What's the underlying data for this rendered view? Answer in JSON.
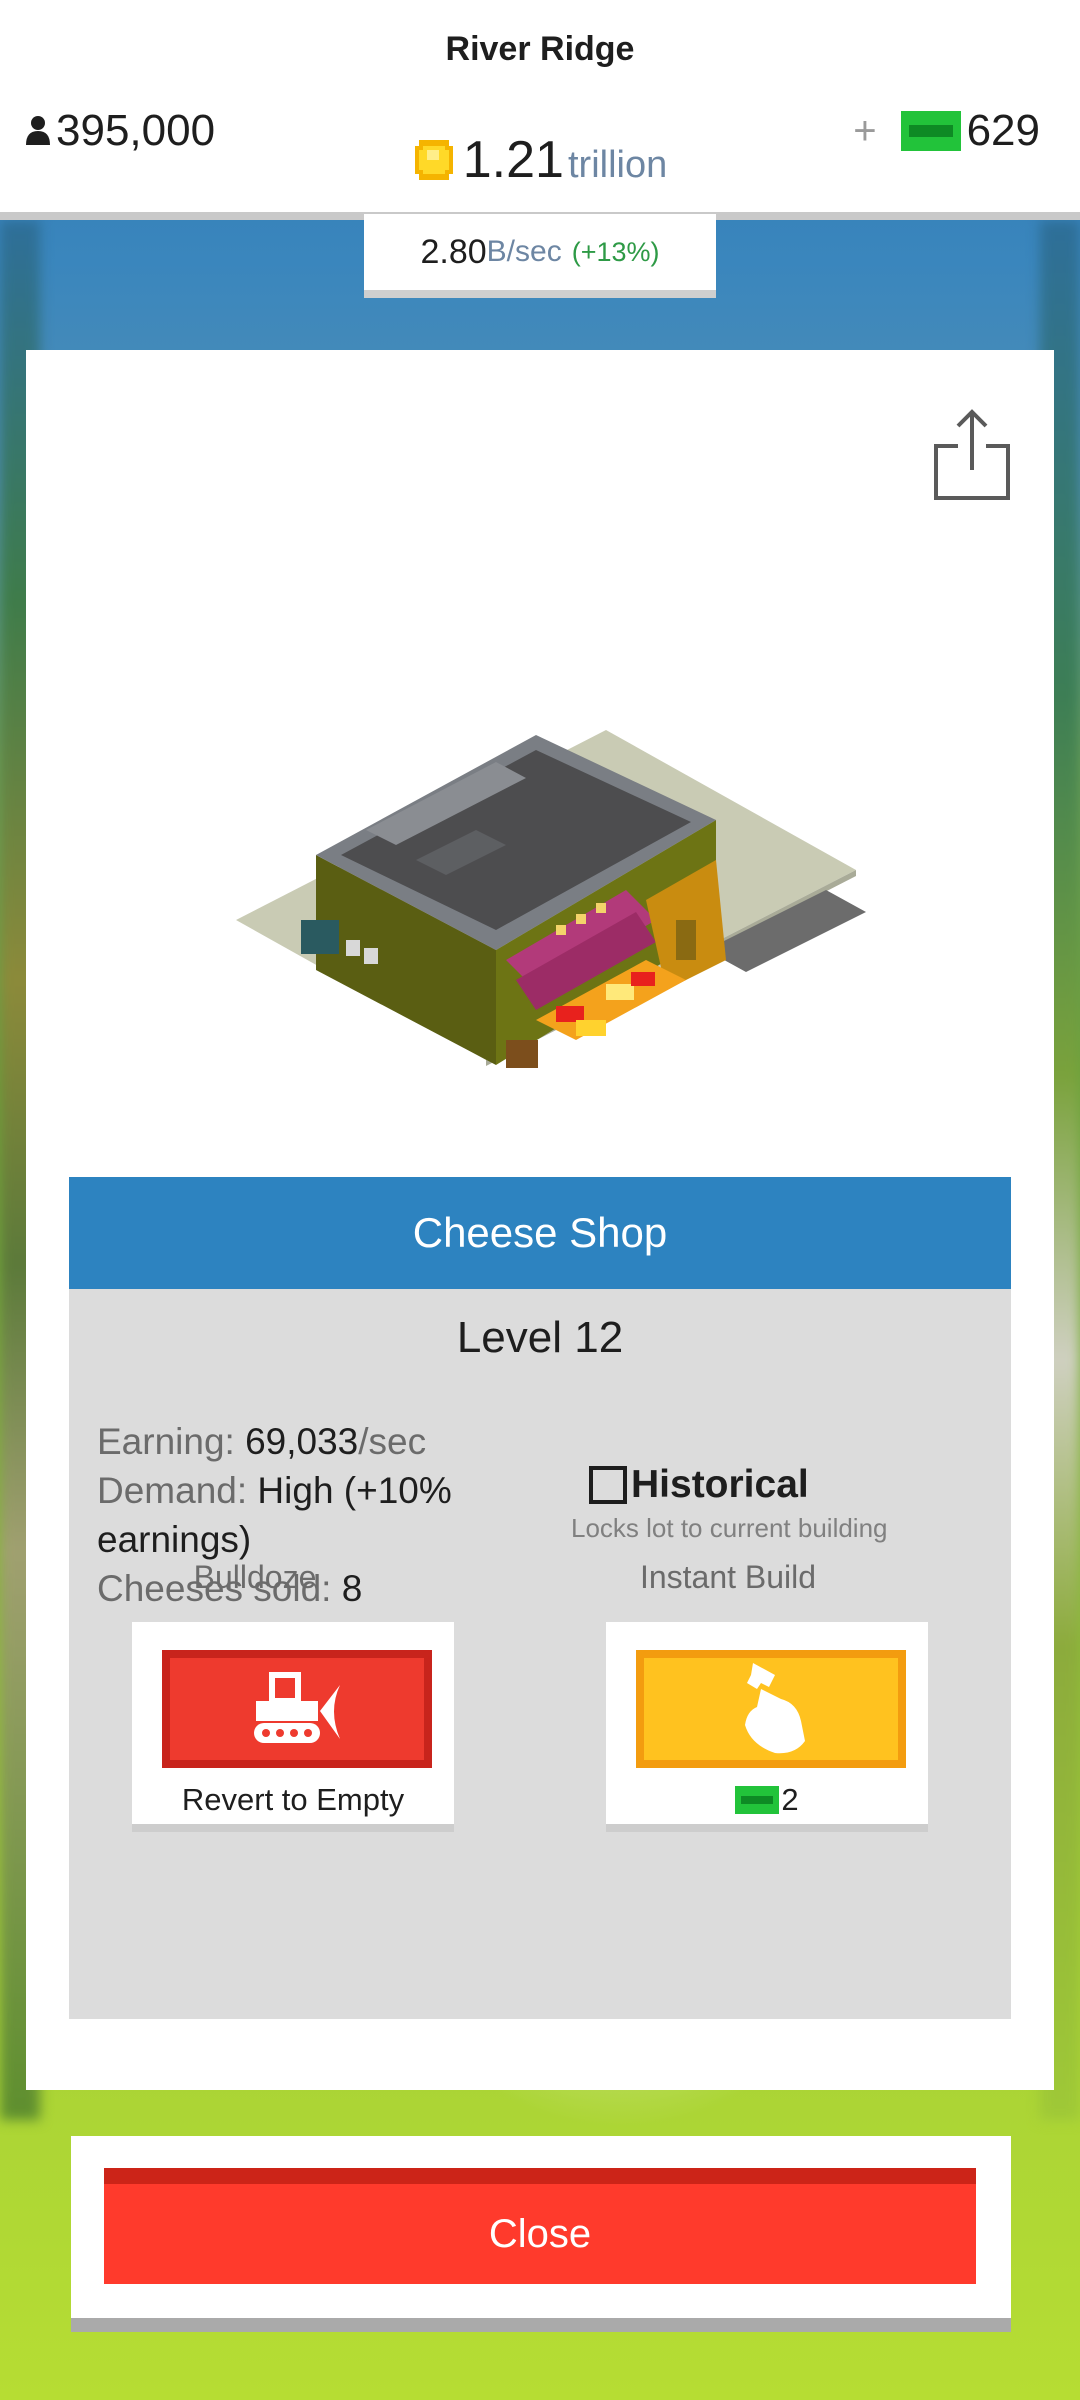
{
  "header": {
    "city_name": "River Ridge",
    "population": "395,000",
    "coins_value": "1.21",
    "coins_unit": "trillion",
    "cash_plus": "+",
    "cash_amount": "629",
    "rate_value": "2.80",
    "rate_unit": "B/sec",
    "rate_bonus": "(+13%)"
  },
  "building": {
    "name": "Cheese Shop",
    "level": "Level 12",
    "earning_label": "Earning:",
    "earning_value": "69,033",
    "earning_unit": "/sec",
    "demand_label": "Demand:",
    "demand_value": "High (+10% earnings)",
    "sold_label": "Cheeses sold:",
    "sold_value": "8"
  },
  "historical": {
    "label": "Historical",
    "description": "Locks lot to current building",
    "checked": false
  },
  "actions": {
    "bulldoze_title": "Bulldoze",
    "bulldoze_caption": "Revert to Empty",
    "instant_build_title": "Instant Build",
    "instant_build_cost": "2"
  },
  "close_label": "Close",
  "icons": {
    "population": "person-icon",
    "coins": "coin-icon",
    "cash": "cash-bill-icon",
    "share": "share-icon",
    "bulldoze": "bulldozer-icon",
    "instant_build": "hammer-icon"
  },
  "colors": {
    "header_blue": "#2d83c0",
    "bulldoze_red": "#ee3a2e",
    "build_yellow": "#ffc21f",
    "close_red": "#ff3a2c",
    "cash_green": "#22c33a",
    "bonus_green": "#2e9a46"
  }
}
